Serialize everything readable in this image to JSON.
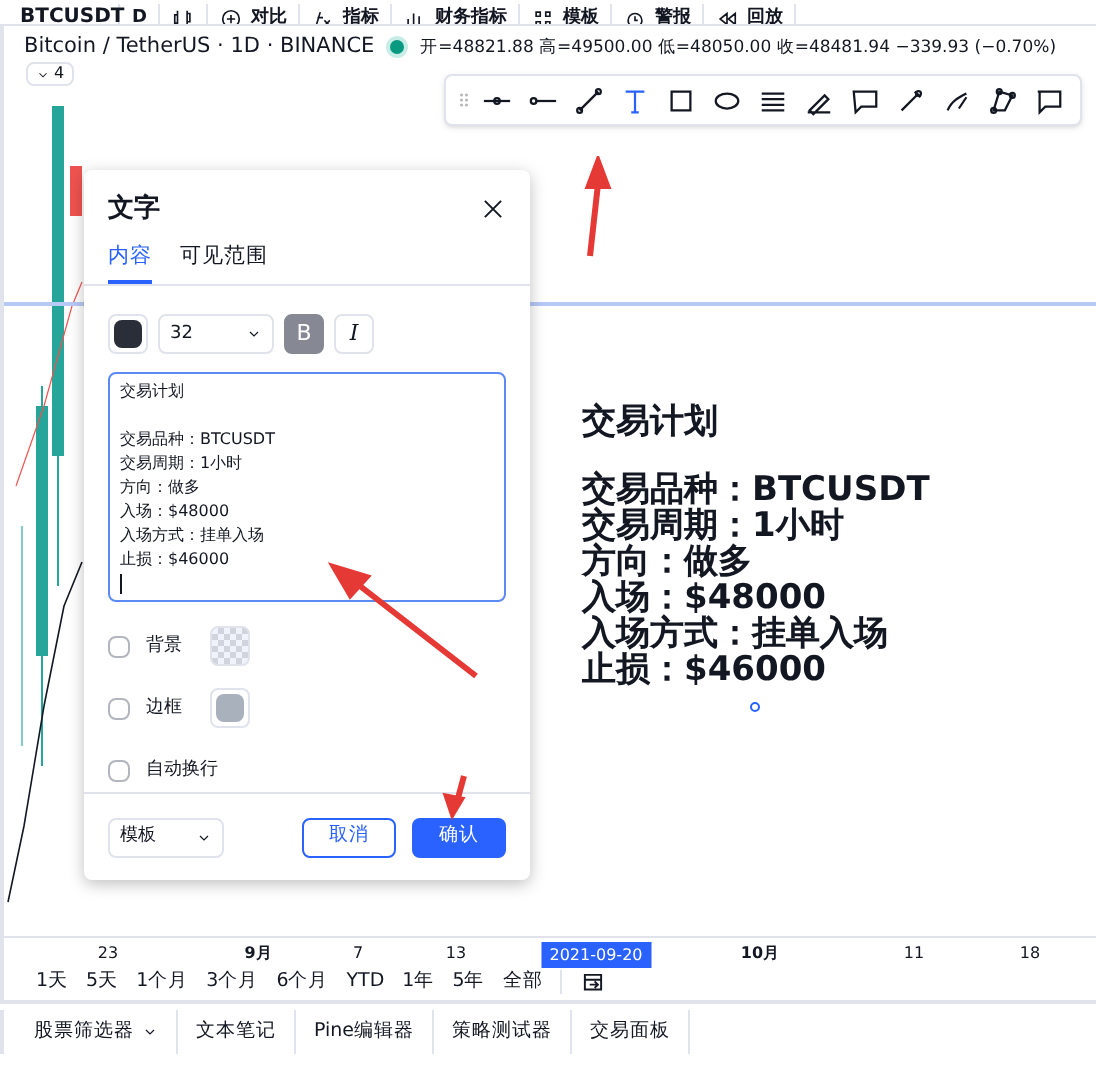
{
  "top_toolbar": [
    {
      "kind": "symbol",
      "label": "BTCUSDT"
    },
    {
      "kind": "text",
      "label": "D"
    },
    {
      "kind": "candles"
    },
    {
      "kind": "plus",
      "label": "对比"
    },
    {
      "kind": "fx",
      "label": "指标"
    },
    {
      "kind": "bars",
      "label": "财务指标"
    },
    {
      "kind": "grid",
      "label": "模板"
    },
    {
      "kind": "alarm",
      "label": "警报"
    },
    {
      "kind": "rewind",
      "label": "回放"
    }
  ],
  "symbol_info": {
    "title": "Bitcoin / TetherUS · 1D · BINANCE",
    "ohlc": "开=48821.88 高=49500.00 低=48050.00 收=48481.94 −339.93 (−0.70%)",
    "collapse_count": "4"
  },
  "drawing_toolbar": [
    {
      "kind": "dotline",
      "selected": false
    },
    {
      "kind": "rayline",
      "selected": false
    },
    {
      "kind": "trend",
      "selected": false
    },
    {
      "kind": "text",
      "selected": true
    },
    {
      "kind": "rect",
      "selected": false
    },
    {
      "kind": "ellipse",
      "selected": false
    },
    {
      "kind": "lines",
      "selected": false
    },
    {
      "kind": "pen",
      "selected": false
    },
    {
      "kind": "callout",
      "selected": false
    },
    {
      "kind": "brush",
      "selected": false
    },
    {
      "kind": "brush2",
      "selected": false
    },
    {
      "kind": "nodes",
      "selected": false
    },
    {
      "kind": "comment",
      "selected": false
    }
  ],
  "chart_text": {
    "title": "交易计划",
    "lines": [
      "交易品种：BTCUSDT",
      "交易周期：1小时",
      "方向：做多",
      "入场：$48000",
      "入场方式：挂单入场",
      "止损：$46000"
    ]
  },
  "dialog": {
    "title": "文字",
    "tabs": [
      {
        "label": "内容",
        "selected": true
      },
      {
        "label": "可见范围",
        "selected": false
      }
    ],
    "font_size": "32",
    "bold": {
      "label": "B",
      "on": true
    },
    "italic": {
      "label": "I",
      "on": false
    },
    "text_title": "交易计划",
    "text_lines": [
      "交易品种：BTCUSDT",
      "交易周期：1小时",
      "方向：做多",
      "入场：$48000",
      "入场方式：挂单入场",
      "止损：$46000"
    ],
    "options": [
      {
        "kind": "pattern",
        "label": "背景",
        "checked": false
      },
      {
        "kind": "swatch",
        "label": "边框",
        "checked": false
      },
      {
        "kind": "plain",
        "label": "自动换行",
        "checked": false
      }
    ],
    "template": "模板",
    "cancel": "取消",
    "confirm": "确认"
  },
  "time_axis": [
    {
      "label": "23",
      "bold": false,
      "selected": false
    },
    {
      "label": "9月",
      "bold": true,
      "selected": false
    },
    {
      "label": "7",
      "bold": false,
      "selected": false
    },
    {
      "label": "13",
      "bold": false,
      "selected": false
    },
    {
      "label": "2021-09-20",
      "bold": false,
      "selected": true
    },
    {
      "label": "10月",
      "bold": true,
      "selected": false
    },
    {
      "label": "11",
      "bold": false,
      "selected": false
    },
    {
      "label": "18",
      "bold": false,
      "selected": false
    }
  ],
  "ranges": [
    "1天",
    "5天",
    "1个月",
    "3个月",
    "6个月",
    "YTD",
    "1年",
    "5年",
    "全部"
  ],
  "bottom_tabs": [
    {
      "label": "股票筛选器",
      "dropdown": true
    },
    {
      "label": "文本笔记",
      "dropdown": false
    },
    {
      "label": "Pine编辑器",
      "dropdown": false
    },
    {
      "label": "策略测试器",
      "dropdown": false
    },
    {
      "label": "交易面板",
      "dropdown": false
    }
  ]
}
